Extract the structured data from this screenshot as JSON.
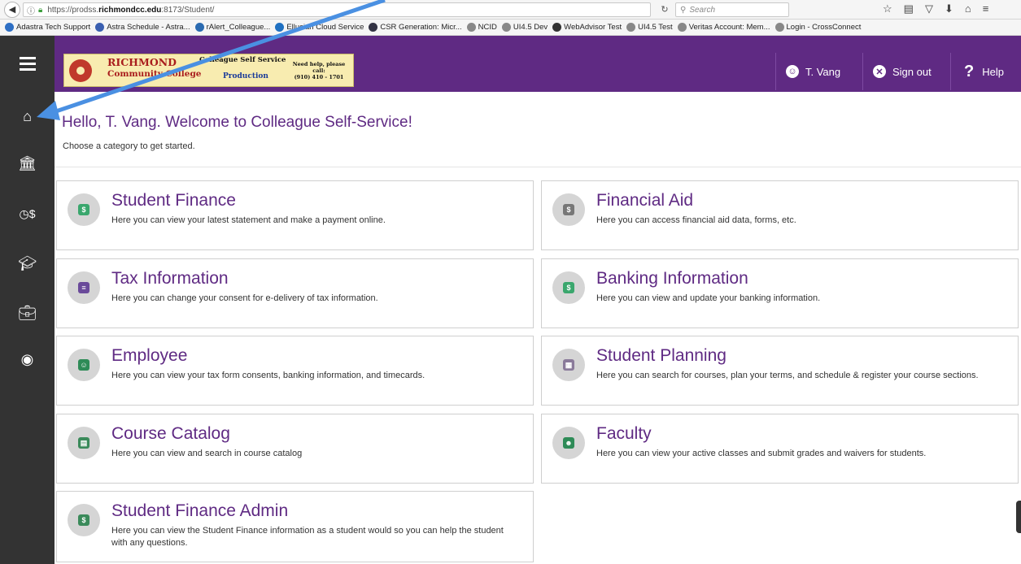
{
  "browser": {
    "url_prefix": "https://prodss.",
    "url_domain": "richmondcc.edu",
    "url_suffix": ":8173/Student/",
    "search_placeholder": "Search",
    "bookmarks": [
      {
        "label": "Adastra Tech Support",
        "color": "#2e6fc4"
      },
      {
        "label": "Astra Schedule - Astra...",
        "color": "#3a5fb0"
      },
      {
        "label": "rAlert_Colleague...",
        "color": "#2a6ab0"
      },
      {
        "label": "Ellucian Cloud Service",
        "color": "#1f70c1"
      },
      {
        "label": "CSR Generation: Micr...",
        "color": "#334"
      },
      {
        "label": "NCID",
        "color": "#888"
      },
      {
        "label": "UI4.5 Dev",
        "color": "#888"
      },
      {
        "label": "WebAdvisor Test",
        "color": "#333"
      },
      {
        "label": "UI4.5 Test",
        "color": "#888"
      },
      {
        "label": "Veritas Account: Mem...",
        "color": "#888"
      },
      {
        "label": "Login - CrossConnect",
        "color": "#888"
      }
    ]
  },
  "header": {
    "logo_line1": "RICHMOND",
    "logo_line2": "Community College",
    "logo_self_service": "Colleague Self Service",
    "logo_environment": "Production",
    "logo_help_line1": "Need help, please call:",
    "logo_help_line2": "(910) 410 - 1701",
    "user_label": "T. Vang",
    "signout_label": "Sign out",
    "help_label": "Help"
  },
  "main": {
    "greeting": "Hello, T. Vang. Welcome to Colleague Self-Service!",
    "subtitle": "Choose a category to get started.",
    "cards": [
      {
        "title": "Student Finance",
        "desc": "Here you can view your latest statement and make a payment online.",
        "icon": "dollar-icon",
        "glyph": "$",
        "color": "#3aa76d"
      },
      {
        "title": "Financial Aid",
        "desc": "Here you can access financial aid data, forms, etc.",
        "icon": "financial-aid-icon",
        "glyph": "$",
        "color": "#777"
      },
      {
        "title": "Tax Information",
        "desc": "Here you can change your consent for e-delivery of tax information.",
        "icon": "tax-document-icon",
        "glyph": "≡",
        "color": "#6a4a9a"
      },
      {
        "title": "Banking Information",
        "desc": "Here you can view and update your banking information.",
        "icon": "bank-money-icon",
        "glyph": "$",
        "color": "#3aa76d"
      },
      {
        "title": "Employee",
        "desc": "Here you can view your tax form consents, banking information, and timecards.",
        "icon": "employee-icon",
        "glyph": "☺",
        "color": "#2e8b57"
      },
      {
        "title": "Student Planning",
        "desc": "Here you can search for courses, plan your terms, and schedule & register your course sections.",
        "icon": "calendar-icon",
        "glyph": "▦",
        "color": "#8a7a9a"
      },
      {
        "title": "Course Catalog",
        "desc": "Here you can view and search in course catalog",
        "icon": "catalog-book-icon",
        "glyph": "▤",
        "color": "#3a8a5a"
      },
      {
        "title": "Faculty",
        "desc": "Here you can view your active classes and submit grades and waivers for students.",
        "icon": "faculty-icon",
        "glyph": "☻",
        "color": "#2e8b57"
      },
      {
        "title": "Student Finance Admin",
        "desc": "Here you can view the Student Finance information as a student would so you can help the student with any questions.",
        "icon": "admin-finance-icon",
        "glyph": "$",
        "color": "#3a8a5a"
      }
    ]
  },
  "colors": {
    "brand_purple": "#5f2a83",
    "sidebar_dark": "#333333",
    "annotation_arrow": "#4a90e2"
  }
}
